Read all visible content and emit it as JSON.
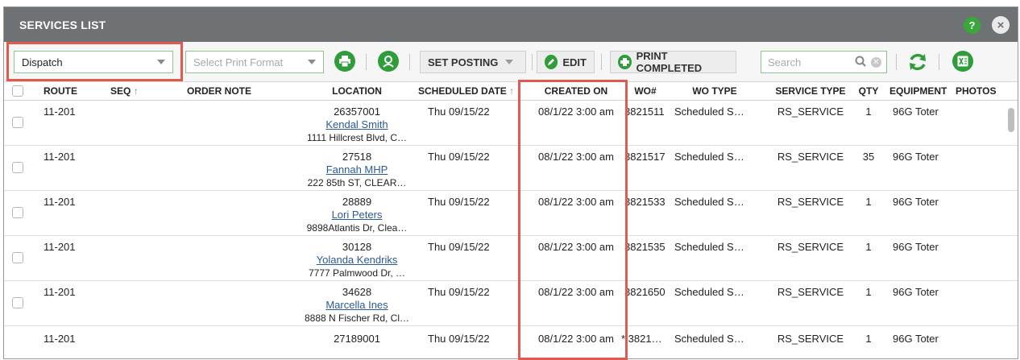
{
  "window": {
    "title": "SERVICES LIST",
    "help_label": "?",
    "close_label": "×"
  },
  "toolbar": {
    "dispatch_select": "Dispatch",
    "print_format_placeholder": "Select Print Format",
    "set_posting_label": "SET POSTING",
    "edit_label": "EDIT",
    "print_completed_label": "PRINT COMPLETED",
    "search_placeholder": "Search"
  },
  "columns": [
    "ROUTE",
    "SEQ",
    "ORDER NOTE",
    "LOCATION",
    "SCHEDULED DATE",
    "CREATED ON",
    "WO#",
    "WO TYPE",
    "SERVICE TYPE",
    "QTY",
    "EQUIPMENT",
    "PHOTOS"
  ],
  "rows": [
    {
      "route": "11-201",
      "loc_id": "26357001",
      "loc_name": "Kendal Smith",
      "loc_addr": "1111 Hillcrest Blvd, C…",
      "scheduled": "Thu 09/15/22",
      "created": "08/1/22 3:00 am",
      "wo": "3821511",
      "wo_type": "Scheduled S…",
      "service_type": "RS_SERVICE",
      "qty": "1",
      "equipment": "96G Toter"
    },
    {
      "route": "11-201",
      "loc_id": "27518",
      "loc_name": "Fannah MHP",
      "loc_addr": "222 85th ST, CLEAR…",
      "scheduled": "Thu 09/15/22",
      "created": "08/1/22 3:00 am",
      "wo": "3821517",
      "wo_type": "Scheduled S…",
      "service_type": "RS_SERVICE",
      "qty": "35",
      "equipment": "96G Toter"
    },
    {
      "route": "11-201",
      "loc_id": "28889",
      "loc_name": "Lori Peters",
      "loc_addr": "9898Atlantis Dr, Clea…",
      "scheduled": "Thu 09/15/22",
      "created": "08/1/22 3:00 am",
      "wo": "3821533",
      "wo_type": "Scheduled S…",
      "service_type": "RS_SERVICE",
      "qty": "1",
      "equipment": "96G Toter"
    },
    {
      "route": "11-201",
      "loc_id": "30128",
      "loc_name": "Yolanda Kendriks",
      "loc_addr": "7777 Palmwood Dr, …",
      "scheduled": "Thu 09/15/22",
      "created": "08/1/22 3:00 am",
      "wo": "3821535",
      "wo_type": "Scheduled S…",
      "service_type": "RS_SERVICE",
      "qty": "1",
      "equipment": "96G Toter"
    },
    {
      "route": "11-201",
      "loc_id": "34628",
      "loc_name": "Marcella Ines",
      "loc_addr": "8888 N Fischer Rd, Cl…",
      "scheduled": "Thu 09/15/22",
      "created": "08/1/22 3:00 am",
      "wo": "3821650",
      "wo_type": "Scheduled S…",
      "service_type": "RS_SERVICE",
      "qty": "1",
      "equipment": "96G Toter"
    },
    {
      "route": "11-201",
      "loc_id": "27189001",
      "scheduled": "Thu 09/15/22",
      "created": "08/1/22 3:00 am",
      "wo": "* 3821…",
      "wo_type": "Scheduled S…",
      "service_type": "RS_SERVICE",
      "qty": "1",
      "equipment": "96G Toter"
    }
  ],
  "colors": {
    "titlebar": "#6e7275",
    "accent_green": "#2e9d3a",
    "highlight": "#e15a4f",
    "link": "#2a5a9a"
  }
}
